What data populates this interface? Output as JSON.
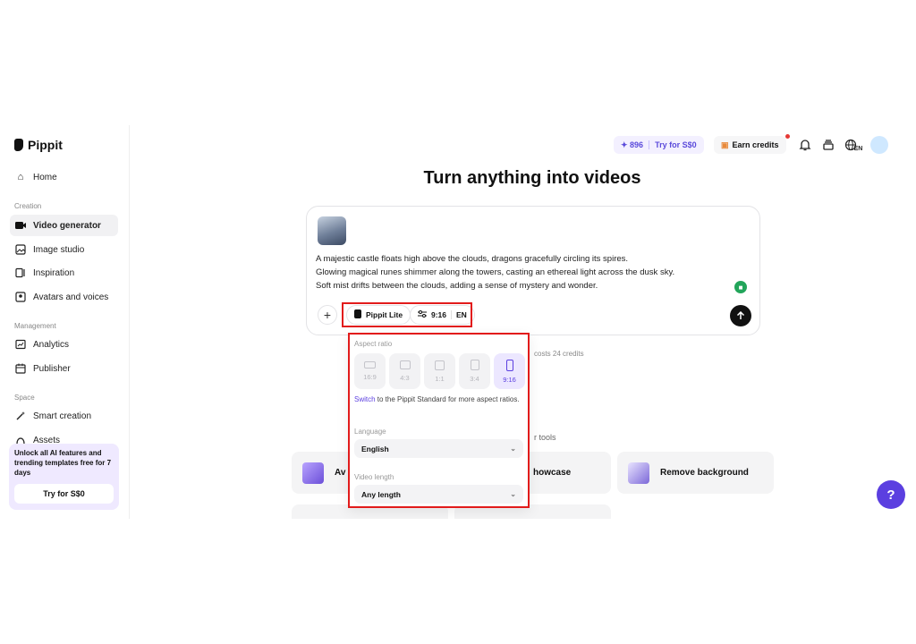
{
  "brand": {
    "name": "Pippit"
  },
  "sidebar": {
    "home": "Home",
    "sections": {
      "creation": "Creation",
      "management": "Management",
      "space": "Space"
    },
    "items": {
      "video_generator": "Video generator",
      "image_studio": "Image studio",
      "inspiration": "Inspiration",
      "avatars_voices": "Avatars and voices",
      "analytics": "Analytics",
      "publisher": "Publisher",
      "smart_creation": "Smart creation",
      "assets": "Assets"
    },
    "promo": {
      "text": "Unlock all AI features and trending templates free for 7 days",
      "button": "Try for S$0"
    }
  },
  "header": {
    "credits": "✦ 896",
    "try_label": "Try for S$0",
    "earn_credits": "Earn credits",
    "language_badge": "EN",
    "icons": [
      "bell-icon",
      "stack-icon",
      "globe-icon"
    ]
  },
  "main": {
    "title": "Turn anything into videos",
    "prompt_lines": [
      "A majestic castle floats high above the clouds, dragons gracefully circling its spires.",
      "Glowing magical runes shimmer along the towers, casting an ethereal light across the dusk sky.",
      "Soft mist drifts between the clouds, adding a sense of mystery and wonder."
    ],
    "model_chip": "Pippit Lite",
    "settings_chip": {
      "ratio": "9:16",
      "lang": "EN"
    },
    "cost_text": "costs 24 credits",
    "tools_label": "r tools",
    "tools": {
      "card1": "Av",
      "card2": "howcase",
      "card3": "Remove background"
    }
  },
  "dropdown": {
    "aspect_label": "Aspect ratio",
    "ratios": [
      "16:9",
      "4:3",
      "1:1",
      "3:4",
      "9:16"
    ],
    "selected_ratio": "9:16",
    "switch_link": "Switch",
    "switch_rest": " to the Pippit Standard for more aspect ratios.",
    "language_label": "Language",
    "language_value": "English",
    "length_label": "Video length",
    "length_value": "Any length"
  },
  "colors": {
    "accent": "#5b3fe0",
    "highlight": "#e21b1b",
    "promo_bg": "#efe9ff"
  }
}
